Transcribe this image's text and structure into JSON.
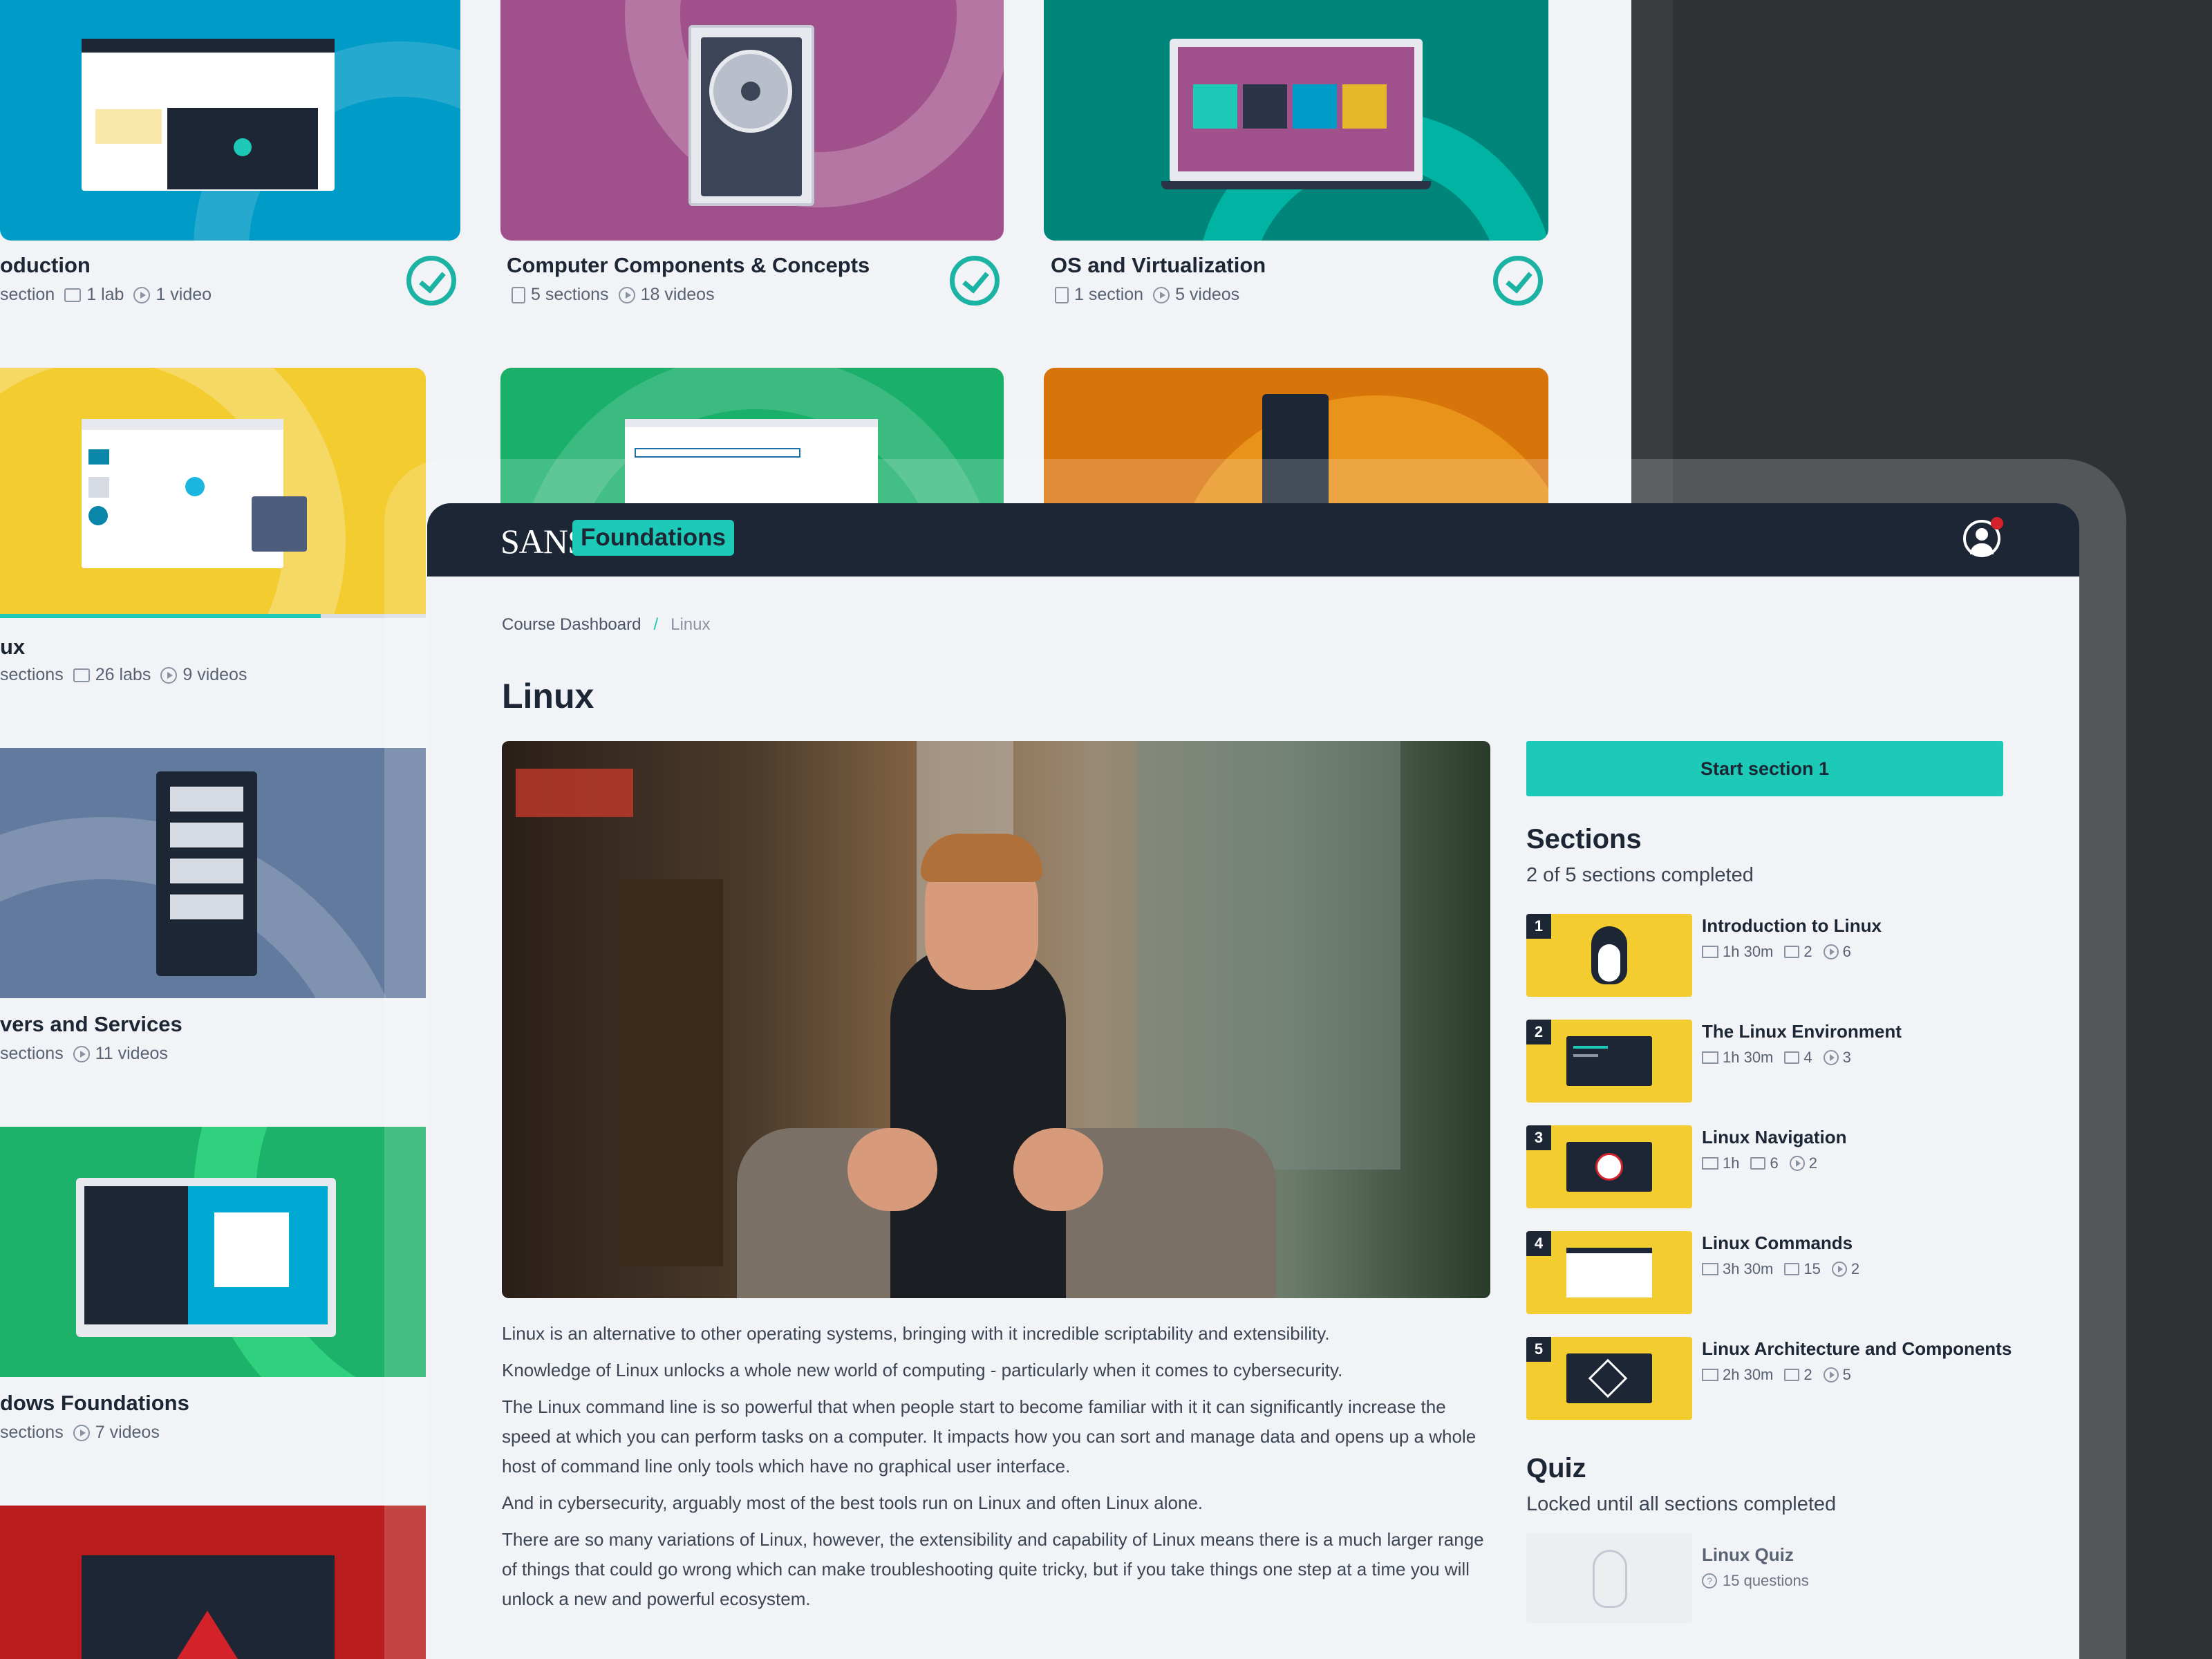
{
  "background_cards": [
    {
      "title": "oduction",
      "meta": [
        {
          "icon": "section-icon",
          "text": "section"
        },
        {
          "icon": "lab-icon",
          "text": "1 lab"
        },
        {
          "icon": "video-icon",
          "text": "1 video"
        }
      ],
      "color": "#009bc6",
      "completed": true
    },
    {
      "title": "Computer Components & Concepts",
      "meta": [
        {
          "icon": "section-icon",
          "text": "5 sections"
        },
        {
          "icon": "video-icon",
          "text": "18 videos"
        }
      ],
      "color": "#a0508a",
      "completed": true
    },
    {
      "title": "OS and Virtualization",
      "meta": [
        {
          "icon": "section-icon",
          "text": "1 section"
        },
        {
          "icon": "video-icon",
          "text": "5 videos"
        }
      ],
      "color": "#00857a",
      "completed": true
    },
    {
      "title": "ux",
      "meta": [
        {
          "icon": "section-icon",
          "text": "sections"
        },
        {
          "icon": "lab-icon",
          "text": "26 labs"
        },
        {
          "icon": "video-icon",
          "text": "9 videos"
        }
      ],
      "color": "#f3cc30",
      "progress": 0.75
    },
    {
      "title": "",
      "color": "#1ab06a"
    },
    {
      "title": "",
      "color": "#d8750a"
    },
    {
      "title": "vers and Services",
      "meta": [
        {
          "icon": "section-icon",
          "text": "sections"
        },
        {
          "icon": "video-icon",
          "text": "11 videos"
        }
      ],
      "color": "#637a9f"
    },
    {
      "title": "dows Foundations",
      "meta": [
        {
          "icon": "section-icon",
          "text": "sections"
        },
        {
          "icon": "video-icon",
          "text": "7 videos"
        }
      ],
      "color": "#1db26a"
    },
    {
      "title": "",
      "color": "#b81c1c"
    }
  ],
  "header": {
    "brand": "SANS",
    "product": "Foundations"
  },
  "breadcrumb": {
    "root": "Course Dashboard",
    "separator": "/",
    "current": "Linux"
  },
  "page_title": "Linux",
  "description": [
    "Linux is an alternative to other operating systems, bringing with it incredible scriptability and extensibility.",
    "Knowledge of Linux unlocks a whole new world of computing - particularly when it comes to cybersecurity.",
    "The Linux command line is so powerful that when people start to become familiar with it it can significantly increase the speed at which you can perform tasks on a computer. It impacts how you can sort and manage data and opens up a whole host of command line only tools which have no graphical user interface.",
    "And in cybersecurity, arguably most of the best tools run on Linux and often Linux alone.",
    "There are so many variations of Linux, however, the extensibility and capability of Linux means there is a much larger range of things that could go wrong which can make troubleshooting quite tricky, but if you take things one step at a time you will unlock a new and powerful ecosystem."
  ],
  "start_button": "Start section 1",
  "sections": {
    "heading": "Sections",
    "progress_text": "2 of 5 sections completed",
    "items": [
      {
        "num": "1",
        "title": "Introduction to Linux",
        "duration": "1h 30m",
        "labs": "2",
        "videos": "6",
        "thumb": "tux-icon"
      },
      {
        "num": "2",
        "title": "The Linux Environment",
        "duration": "1h 30m",
        "labs": "4",
        "videos": "3",
        "thumb": "terminal-icon"
      },
      {
        "num": "3",
        "title": "Linux Navigation",
        "duration": "1h",
        "labs": "6",
        "videos": "2",
        "thumb": "compass-icon"
      },
      {
        "num": "4",
        "title": "Linux Commands",
        "duration": "3h 30m",
        "labs": "15",
        "videos": "2",
        "thumb": "window-icon"
      },
      {
        "num": "5",
        "title": "Linux Architecture and Components",
        "duration": "2h 30m",
        "labs": "2",
        "videos": "5",
        "thumb": "grid-icon"
      }
    ]
  },
  "quiz": {
    "heading": "Quiz",
    "status": "Locked until all sections completed",
    "title": "Linux Quiz",
    "questions": "15 questions"
  }
}
